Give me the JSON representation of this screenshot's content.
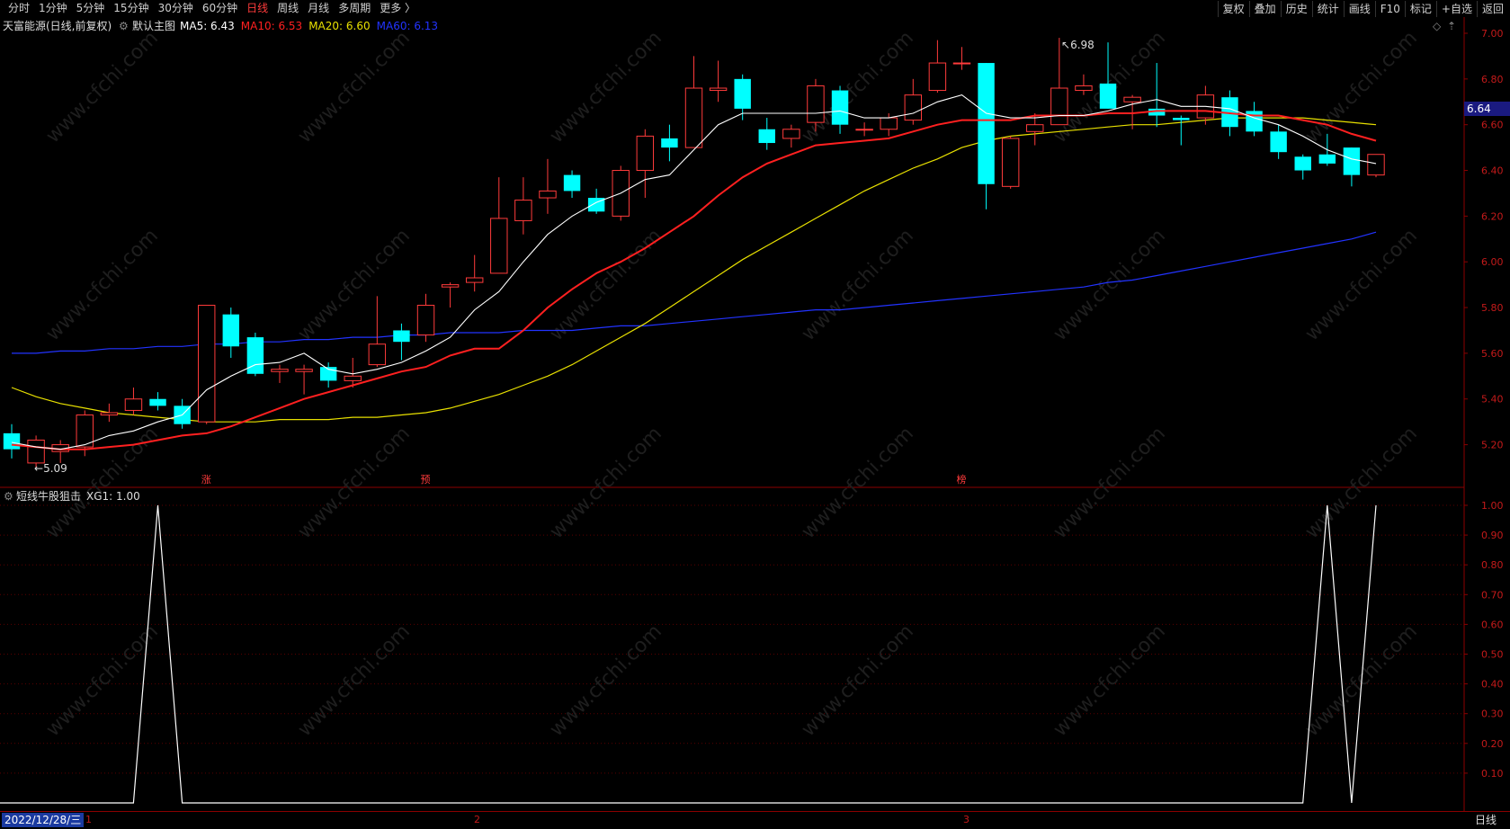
{
  "toolbar": {
    "periods": [
      "分时",
      "1分钟",
      "5分钟",
      "15分钟",
      "30分钟",
      "60分钟",
      "日线",
      "周线",
      "月线",
      "多周期",
      "更多 〉"
    ],
    "active_period": "日线",
    "actions": [
      "复权",
      "叠加",
      "历史",
      "统计",
      "画线",
      "F10",
      "标记",
      "+自选",
      "返回"
    ]
  },
  "main_panel": {
    "stock_name": "天富能源(日线,前复权)",
    "chart_label": "默认主图",
    "ma": [
      {
        "label": "MA5: 6.43",
        "color": "#ffffff"
      },
      {
        "label": "MA10: 6.53",
        "color": "#ff2020"
      },
      {
        "label": "MA20: 6.60",
        "color": "#e8e000"
      },
      {
        "label": "MA60: 6.13",
        "color": "#2233ff"
      }
    ],
    "high_marker": "6.98",
    "low_marker": "5.09",
    "last_price": "6.64",
    "event_marks": [
      "涨",
      "预",
      "榜"
    ],
    "y_ticks": [
      "7.00",
      "6.80",
      "6.60",
      "6.40",
      "6.20",
      "6.00",
      "5.80",
      "5.60",
      "5.40",
      "5.20"
    ]
  },
  "indicator_panel": {
    "title": "短线牛股狙击",
    "value_label": "XG1: 1.00",
    "y_ticks": [
      "1.00",
      "0.90",
      "0.80",
      "0.70",
      "0.60",
      "0.50",
      "0.40",
      "0.30",
      "0.20",
      "0.10"
    ]
  },
  "status": {
    "date": "2022/12/28/三",
    "month_marks": [
      "1",
      "2",
      "3"
    ],
    "period_label": "日线"
  },
  "chart_data": {
    "type": "candlestick",
    "price_axis": [
      5.1,
      7.0
    ],
    "candles": [
      [
        5.25,
        5.18,
        5.29,
        5.14
      ],
      [
        5.12,
        5.22,
        5.24,
        5.1
      ],
      [
        5.17,
        5.2,
        5.22,
        5.12
      ],
      [
        5.19,
        5.33,
        5.35,
        5.15
      ],
      [
        5.33,
        5.34,
        5.38,
        5.3
      ],
      [
        5.35,
        5.4,
        5.45,
        5.33
      ],
      [
        5.4,
        5.37,
        5.43,
        5.35
      ],
      [
        5.37,
        5.29,
        5.4,
        5.27
      ],
      [
        5.3,
        5.81,
        5.81,
        5.29
      ],
      [
        5.77,
        5.63,
        5.8,
        5.58
      ],
      [
        5.67,
        5.51,
        5.69,
        5.5
      ],
      [
        5.52,
        5.53,
        5.55,
        5.47
      ],
      [
        5.52,
        5.53,
        5.55,
        5.42
      ],
      [
        5.54,
        5.48,
        5.56,
        5.45
      ],
      [
        5.48,
        5.5,
        5.58,
        5.45
      ],
      [
        5.55,
        5.64,
        5.85,
        5.54
      ],
      [
        5.7,
        5.65,
        5.73,
        5.57
      ],
      [
        5.68,
        5.81,
        5.86,
        5.65
      ],
      [
        5.89,
        5.9,
        5.91,
        5.8
      ],
      [
        5.91,
        5.93,
        6.03,
        5.87
      ],
      [
        5.95,
        6.19,
        6.37,
        5.95
      ],
      [
        6.18,
        6.27,
        6.37,
        6.12
      ],
      [
        6.28,
        6.31,
        6.45,
        6.21
      ],
      [
        6.38,
        6.31,
        6.4,
        6.28
      ],
      [
        6.28,
        6.22,
        6.32,
        6.21
      ],
      [
        6.2,
        6.4,
        6.42,
        6.18
      ],
      [
        6.4,
        6.55,
        6.58,
        6.28
      ],
      [
        6.54,
        6.5,
        6.6,
        6.44
      ],
      [
        6.5,
        6.76,
        6.9,
        6.5
      ],
      [
        6.75,
        6.76,
        6.88,
        6.7
      ],
      [
        6.8,
        6.67,
        6.82,
        6.62
      ],
      [
        6.58,
        6.52,
        6.63,
        6.49
      ],
      [
        6.54,
        6.58,
        6.6,
        6.5
      ],
      [
        6.61,
        6.77,
        6.8,
        6.57
      ],
      [
        6.75,
        6.6,
        6.77,
        6.56
      ],
      [
        6.58,
        6.58,
        6.61,
        6.55
      ],
      [
        6.58,
        6.63,
        6.65,
        6.55
      ],
      [
        6.62,
        6.73,
        6.8,
        6.6
      ],
      [
        6.75,
        6.87,
        6.97,
        6.74
      ],
      [
        6.87,
        6.87,
        6.94,
        6.84
      ],
      [
        6.87,
        6.34,
        6.87,
        6.23
      ],
      [
        6.33,
        6.54,
        6.55,
        6.32
      ],
      [
        6.57,
        6.6,
        6.65,
        6.51
      ],
      [
        6.6,
        6.76,
        6.98,
        6.62
      ],
      [
        6.75,
        6.77,
        6.82,
        6.73
      ],
      [
        6.78,
        6.67,
        6.96,
        6.67
      ],
      [
        6.7,
        6.72,
        6.73,
        6.58
      ],
      [
        6.67,
        6.64,
        6.87,
        6.59
      ],
      [
        6.63,
        6.62,
        6.64,
        6.51
      ],
      [
        6.63,
        6.73,
        6.77,
        6.6
      ],
      [
        6.72,
        6.59,
        6.75,
        6.55
      ],
      [
        6.66,
        6.57,
        6.7,
        6.55
      ],
      [
        6.57,
        6.48,
        6.6,
        6.45
      ],
      [
        6.46,
        6.4,
        6.47,
        6.36
      ],
      [
        6.47,
        6.43,
        6.56,
        6.42
      ],
      [
        6.5,
        6.38,
        6.5,
        6.33
      ],
      [
        6.38,
        6.47,
        6.47,
        6.37
      ]
    ],
    "ma5": [
      5.21,
      5.19,
      5.18,
      5.2,
      5.24,
      5.26,
      5.3,
      5.33,
      5.44,
      5.5,
      5.55,
      5.56,
      5.6,
      5.53,
      5.51,
      5.53,
      5.56,
      5.61,
      5.67,
      5.79,
      5.87,
      6.0,
      6.12,
      6.2,
      6.26,
      6.3,
      6.36,
      6.38,
      6.49,
      6.6,
      6.65,
      6.65,
      6.65,
      6.65,
      6.66,
      6.63,
      6.63,
      6.65,
      6.7,
      6.73,
      6.65,
      6.63,
      6.63,
      6.64,
      6.64,
      6.66,
      6.69,
      6.71,
      6.68,
      6.68,
      6.67,
      6.63,
      6.6,
      6.55,
      6.49,
      6.45,
      6.43
    ],
    "ma10": [
      5.2,
      5.19,
      5.18,
      5.18,
      5.19,
      5.2,
      5.22,
      5.24,
      5.25,
      5.28,
      5.32,
      5.36,
      5.4,
      5.43,
      5.46,
      5.49,
      5.52,
      5.54,
      5.59,
      5.62,
      5.62,
      5.7,
      5.8,
      5.88,
      5.95,
      6.0,
      6.06,
      6.13,
      6.2,
      6.29,
      6.37,
      6.43,
      6.47,
      6.51,
      6.52,
      6.53,
      6.54,
      6.57,
      6.6,
      6.62,
      6.62,
      6.62,
      6.64,
      6.64,
      6.64,
      6.65,
      6.65,
      6.66,
      6.66,
      6.66,
      6.65,
      6.64,
      6.64,
      6.62,
      6.6,
      6.56,
      6.53
    ],
    "ma20": [
      5.45,
      5.41,
      5.38,
      5.36,
      5.34,
      5.33,
      5.32,
      5.31,
      5.3,
      5.3,
      5.3,
      5.31,
      5.31,
      5.31,
      5.32,
      5.32,
      5.33,
      5.34,
      5.36,
      5.39,
      5.42,
      5.46,
      5.5,
      5.55,
      5.61,
      5.67,
      5.73,
      5.8,
      5.87,
      5.94,
      6.01,
      6.07,
      6.13,
      6.19,
      6.25,
      6.31,
      6.36,
      6.41,
      6.45,
      6.5,
      6.53,
      6.55,
      6.56,
      6.57,
      6.58,
      6.59,
      6.6,
      6.6,
      6.61,
      6.62,
      6.63,
      6.63,
      6.63,
      6.63,
      6.62,
      6.61,
      6.6
    ],
    "ma60": [
      5.6,
      5.6,
      5.61,
      5.61,
      5.62,
      5.62,
      5.63,
      5.63,
      5.64,
      5.64,
      5.65,
      5.65,
      5.66,
      5.66,
      5.67,
      5.67,
      5.68,
      5.68,
      5.69,
      5.69,
      5.69,
      5.7,
      5.7,
      5.7,
      5.71,
      5.72,
      5.72,
      5.73,
      5.74,
      5.75,
      5.76,
      5.77,
      5.78,
      5.79,
      5.79,
      5.8,
      5.81,
      5.82,
      5.83,
      5.84,
      5.85,
      5.86,
      5.87,
      5.88,
      5.89,
      5.91,
      5.92,
      5.94,
      5.96,
      5.98,
      6.0,
      6.02,
      6.04,
      6.06,
      6.08,
      6.1,
      6.13
    ],
    "xg1": [
      0,
      0,
      0,
      0,
      0,
      0,
      1,
      0,
      0,
      0,
      0,
      0,
      0,
      0,
      0,
      0,
      0,
      0,
      0,
      0,
      0,
      0,
      0,
      0,
      0,
      0,
      0,
      0,
      0,
      0,
      0,
      0,
      0,
      0,
      0,
      0,
      0,
      0,
      0,
      0,
      0,
      0,
      0,
      0,
      0,
      0,
      0,
      0,
      0,
      0,
      0,
      0,
      0,
      0,
      1,
      0,
      1
    ],
    "indicator_axis": [
      0,
      1
    ]
  }
}
